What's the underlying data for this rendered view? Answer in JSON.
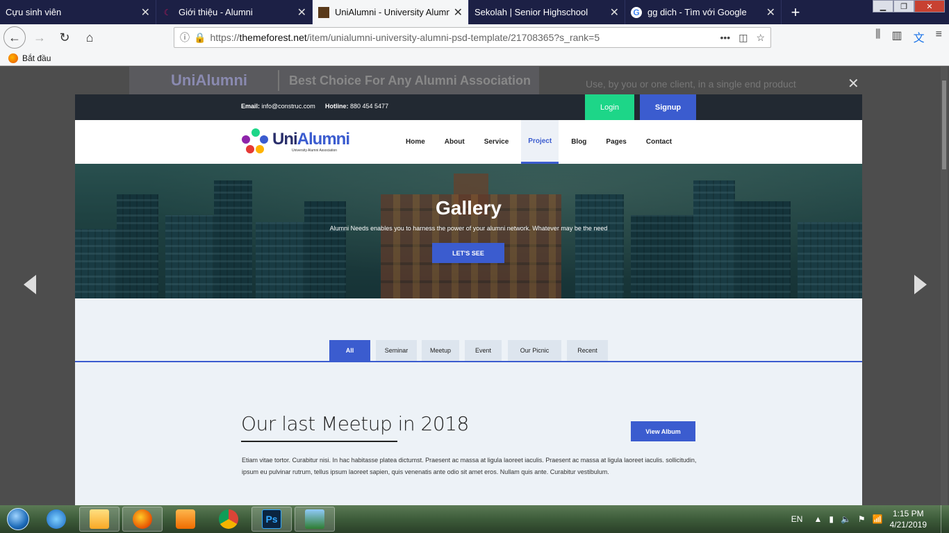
{
  "browser": {
    "tabs": [
      {
        "label": "Cựu sinh viên",
        "active": false
      },
      {
        "label": "Giới thiệu - Alumni",
        "active": false
      },
      {
        "label": "UniAlumni - University Alumni",
        "active": true
      },
      {
        "label": "Sekolah | Senior Highschool",
        "active": false
      },
      {
        "label": "gg dich - Tìm với Google",
        "active": false
      }
    ],
    "url_prefix": "https://",
    "url_domain": "themeforest.net",
    "url_path": "/item/unialumni-university-alumni-psd-template/21708365?s_rank=5",
    "bookmark": "Bắt đầu"
  },
  "background_page": {
    "logo": "UniAlumni",
    "tagline": "Best Choice For Any Alumni Association",
    "side_text": "Use, by you or one client, in a single end product"
  },
  "site": {
    "email_label": "Email:",
    "email": "info@construc.com",
    "hotline_label": "Hotline:",
    "hotline": "880 454 5477",
    "login": "Login",
    "signup": "Signup",
    "logo_uni": "Uni",
    "logo_alumni": "Alumni",
    "logo_sub": "University Alumni Association",
    "menu": [
      "Home",
      "About",
      "Service",
      "Project",
      "Blog",
      "Pages",
      "Contact"
    ],
    "active_menu": "Project",
    "hero": {
      "title": "Gallery",
      "text": "Alumni Needs enables you to harness the power of your alumni network. Whatever may be the need",
      "button": "LET'S SEE"
    },
    "filters": [
      "All",
      "Seminar",
      "Meetup",
      "Event",
      "Our Picnic",
      "Recent"
    ],
    "active_filter": "All",
    "meetup": {
      "title": "Our last Meetup in 2018",
      "button": "View Album",
      "text": "Etiam vitae tortor. Curabitur nisi. In hac habitasse platea dictumst. Praesent ac massa at ligula laoreet iaculis. Praesent ac massa at ligula laoreet iaculis. sollicitudin, ipsum eu pulvinar rutrum, tellus ipsum laoreet sapien, quis venenatis ante odio sit amet eros. Nullam quis ante. Curabitur vestibulum."
    }
  },
  "taskbar": {
    "lang": "EN",
    "time": "1:15 PM",
    "date": "4/21/2019"
  },
  "colors": {
    "accent": "#3b5ccf",
    "login_green": "#1dd688",
    "topbar": "#222932"
  }
}
